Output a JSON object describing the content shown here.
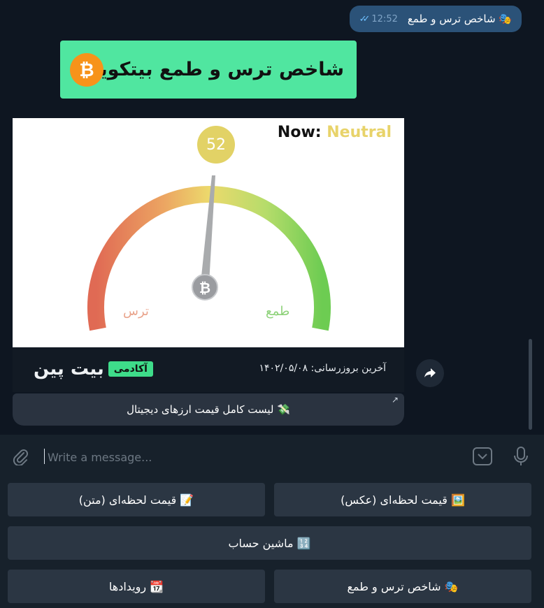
{
  "messages": {
    "outgoing": {
      "text": "🎭 شاخص ترس و طمع",
      "time": "12:52"
    },
    "incoming": {
      "banner_title": "شاخص ترس و طمع بیتکوین",
      "btc_symbol": "₿",
      "gauge": {
        "now_label": "Now:",
        "now_value": "Neutral",
        "value": 52,
        "value_text": "52",
        "fear_label": "ترس",
        "greed_label": "طمع"
      },
      "academy": {
        "brand": "بیت پین",
        "tag": "آکادمی"
      },
      "update_line": "آخرین بروزرسانی:  ۱۴۰۲/۰۵/۰۸",
      "inline_button": "💸 لیست کامل قیمت ارزهای دیجیتال",
      "inline_button_arrow": "↗"
    }
  },
  "composer": {
    "placeholder": "Write a message..."
  },
  "reply_keyboard": [
    {
      "label": "🖼️ قیمت لحظه‌ای (عکس)"
    },
    {
      "label": "📝 قیمت لحظه‌ای (متن)"
    },
    {
      "label": "🔢 ماشین حساب"
    },
    {
      "label": "🎭 شاخص ترس و طمع"
    },
    {
      "label": "📆 رویدادها"
    }
  ],
  "colors": {
    "chat_bg": "#0e1621",
    "outgoing_bubble": "#2b5278",
    "banner_green": "#50e6a0",
    "gauge_neutral": "#e2d266",
    "button_bg": "#2b3643"
  }
}
